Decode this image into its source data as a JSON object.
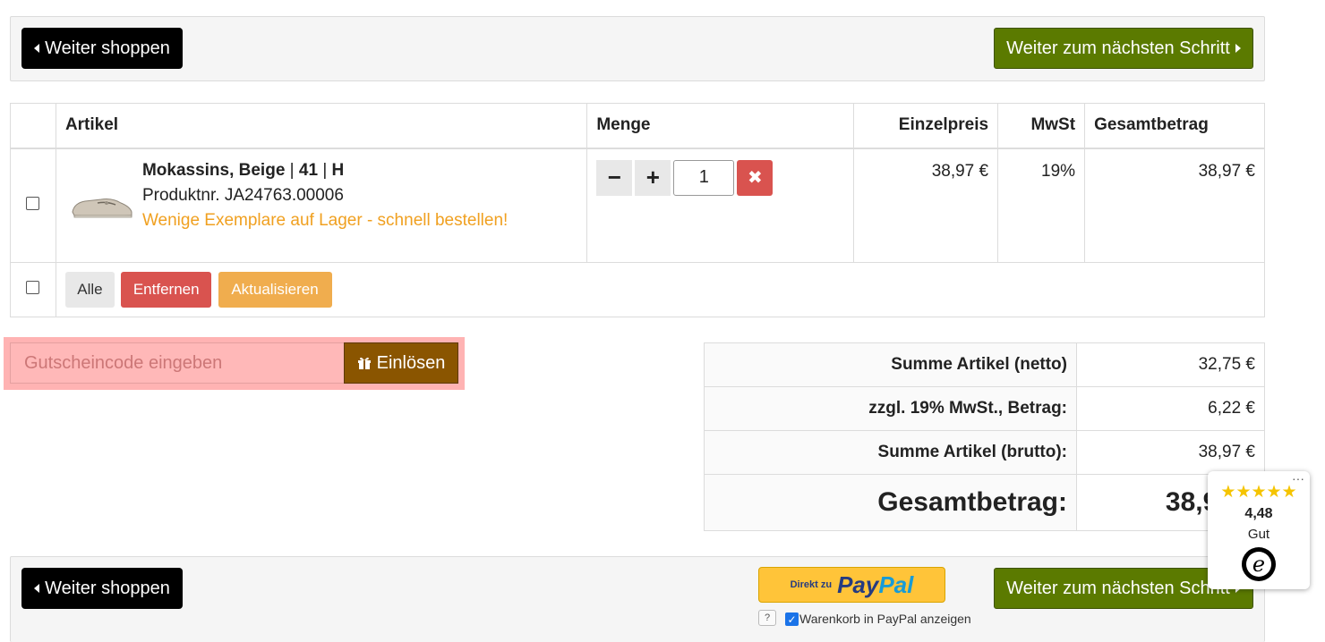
{
  "nav": {
    "continue_shopping": "Weiter shoppen",
    "next_step": "Weiter zum nächsten Schritt"
  },
  "cart": {
    "headers": {
      "article": "Artikel",
      "quantity": "Menge",
      "unit_price": "Einzelpreis",
      "vat": "MwSt",
      "total": "Gesamtbetrag"
    },
    "items": [
      {
        "title": "Mokassins, Beige",
        "size": "41",
        "width": "H",
        "sep": "|",
        "product_no": "Produktnr. JA24763.00006",
        "stock_note": "Wenige Exemplare auf Lager - schnell bestellen!",
        "quantity": "1",
        "unit_price": "38,97 €",
        "vat": "19%",
        "total": "38,97 €"
      }
    ],
    "actions": {
      "all": "Alle",
      "remove": "Entfernen",
      "update": "Aktualisieren"
    },
    "qty_minus": "−",
    "qty_plus": "+",
    "qty_delete": "✖"
  },
  "voucher": {
    "placeholder": "Gutscheincode eingeben",
    "redeem": "Einlösen"
  },
  "summary": {
    "net_label": "Summe Artikel (netto)",
    "net_value": "32,75 €",
    "vat_label": "zzgl. 19% MwSt., Betrag:",
    "vat_value": "6,22 €",
    "gross_label": "Summe Artikel (brutto):",
    "gross_value": "38,97 €",
    "total_label": "Gesamtbetrag:",
    "total_value": "38,97 €"
  },
  "paypal": {
    "direct": "Direkt zu",
    "pay": "Pay",
    "pal": "Pal",
    "help": "?",
    "show_cart_label": "Warenkorb in PayPal anzeigen",
    "show_cart_checked": true
  },
  "trusted_shops": {
    "stars": "★★★★★",
    "score": "4,48",
    "rating_word": "Gut",
    "logo_letter": "e",
    "menu": "···"
  },
  "colors": {
    "black_button": "#000000",
    "green_button": "#5b7a00",
    "remove_red": "#d9534f",
    "update_orange": "#f0ad4e",
    "stock_orange": "#f0a020",
    "voucher_highlight": "#ffb3b3",
    "voucher_button": "#8a5500"
  }
}
